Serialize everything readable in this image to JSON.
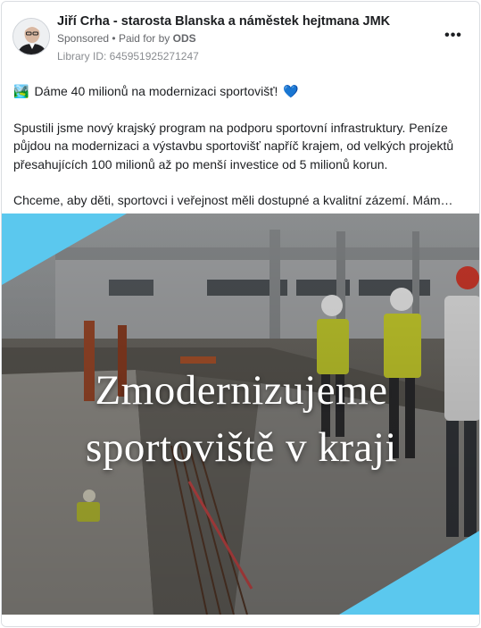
{
  "ad": {
    "advertiser_name": "Jiří Crha - starosta Blanska a náměstek hejtmana JMK",
    "sponsored_label": "Sponsored",
    "separator": "•",
    "paid_for_prefix": "Paid for by",
    "paid_for_by": "ODS",
    "library_id": "Library ID: 645951925271247",
    "more_label": "•••"
  },
  "body": {
    "headline_emoji": "🏞️",
    "headline_text": "Dáme 40 milionů na modernizaci sportovišť!",
    "heart_emoji": "💙",
    "paragraph_1": "Spustili jsme nový krajský program na podporu sportovní infrastruktury. Peníze půjdou na modernizaci a výstavbu sportovišť napříč krajem, od velkých projektů přesahujících 100 milionů až po menší investice od 5 milionů korun.",
    "paragraph_2": "Chceme, aby děti, sportovci i veřejnost měli dostupné a kvalitní zázemí. Mám…"
  },
  "creative": {
    "title_line_1": "Zmodernizujeme",
    "title_line_2": "sportoviště v kraji",
    "accent_color": "#5bc8ee"
  }
}
